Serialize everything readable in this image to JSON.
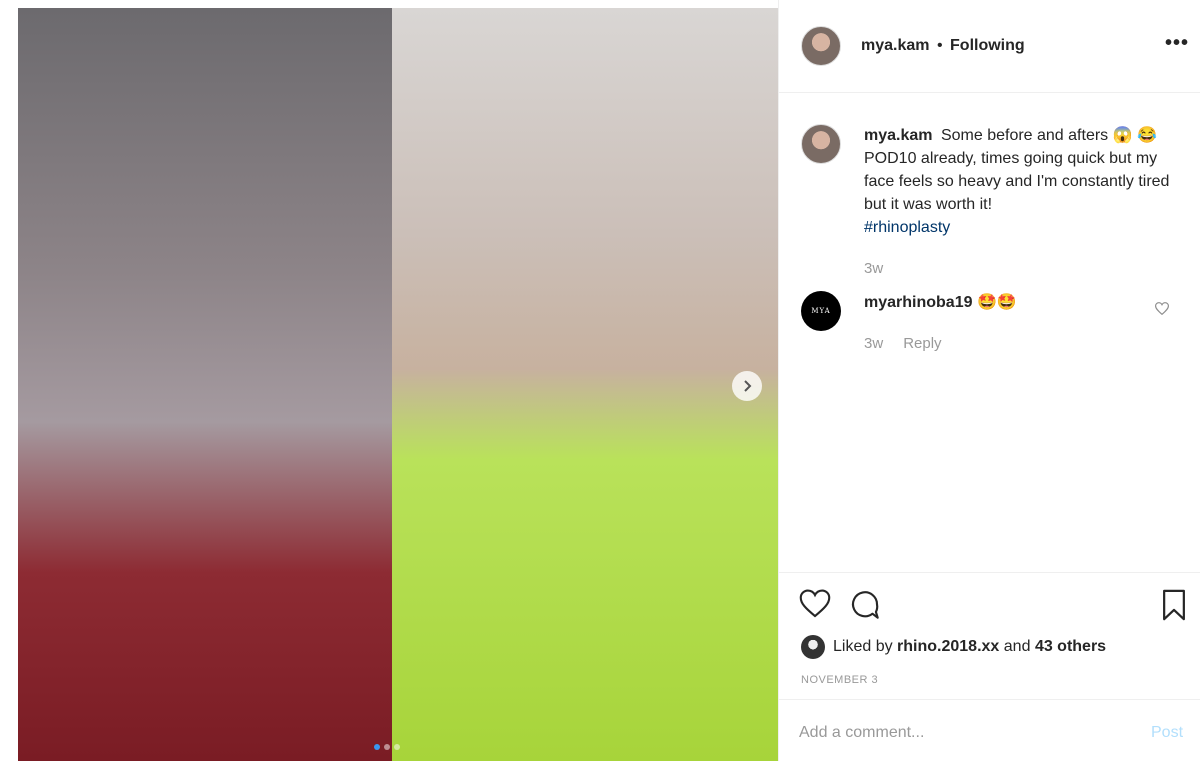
{
  "header": {
    "username": "mya.kam",
    "separator": "•",
    "follow_status": "Following",
    "more_label": "•••"
  },
  "caption": {
    "username": "mya.kam",
    "text_part1": "Some before and afters 😱 😂 POD10 already, times going quick but my face feels so heavy and I'm constantly tired but it was worth it!",
    "hashtag": "#rhinoplasty",
    "time": "3w"
  },
  "comment": {
    "avatar_text": "MYA",
    "username": "myarhinoba19",
    "text": "🤩🤩",
    "time": "3w",
    "reply_label": "Reply"
  },
  "likes": {
    "prefix": "Liked by",
    "user": "rhino.2018.xx",
    "middle": "and",
    "others": "43 others"
  },
  "date": "NOVEMBER 3",
  "add_comment": {
    "placeholder": "Add a comment...",
    "post_label": "Post"
  },
  "colors": {
    "link": "#003569",
    "muted": "#999999",
    "post_disabled": "#b2dffc",
    "carousel_active": "#3897f0"
  },
  "icons": [
    "chevron-right-icon",
    "heart-icon",
    "comment-bubble-icon",
    "bookmark-icon",
    "small-heart-icon"
  ]
}
